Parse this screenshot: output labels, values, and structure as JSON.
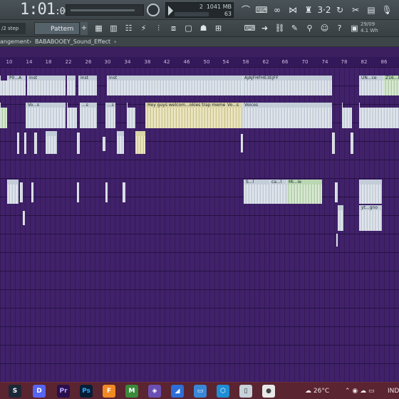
{
  "transport": {
    "time_main": "1:01",
    "time_ms": ":00",
    "display_value_1": "2",
    "display_value_2": "1041 MB",
    "display_value_3": "63"
  },
  "toolbar2": {
    "step_label": "/2 step",
    "pattern_label": "Pattern 1",
    "date": "29/09",
    "sub": "4.1 Wh"
  },
  "breadcrumb": {
    "parent": "angement",
    "separator": "›",
    "current": "BABABOOEY_Sound_Effect",
    "separator2": "›"
  },
  "ruler": [
    "10",
    "14",
    "18",
    "22",
    "26",
    "30",
    "34",
    "38",
    "42",
    "46",
    "50",
    "54",
    "58",
    "62",
    "66",
    "70",
    "74",
    "78",
    "82",
    "86"
  ],
  "clips": {
    "track1": [
      "P0...A",
      "Inst",
      "Inst",
      "Inst",
      "AJAJFHFHE3EJFF",
      "UN...ce",
      "Z16...k"
    ],
    "track2": [
      "Vo...s",
      "...s",
      "...s",
      "Hey guys welcom...okies trap meme",
      "Vo...s",
      "Voices"
    ],
    "track4": [
      "S...l",
      "ca...l",
      "Mi...ie"
    ],
    "track5": [
      "yt...gno"
    ]
  },
  "taskbar": {
    "weather": "26°C",
    "lang": "IND"
  },
  "icons": [
    "play-icon",
    "record-icon",
    "metronome-icon",
    "mixer-icon",
    "piano-roll-icon",
    "browser-icon",
    "plugin-icon",
    "microphone-icon",
    "help-icon",
    "search-icon"
  ]
}
